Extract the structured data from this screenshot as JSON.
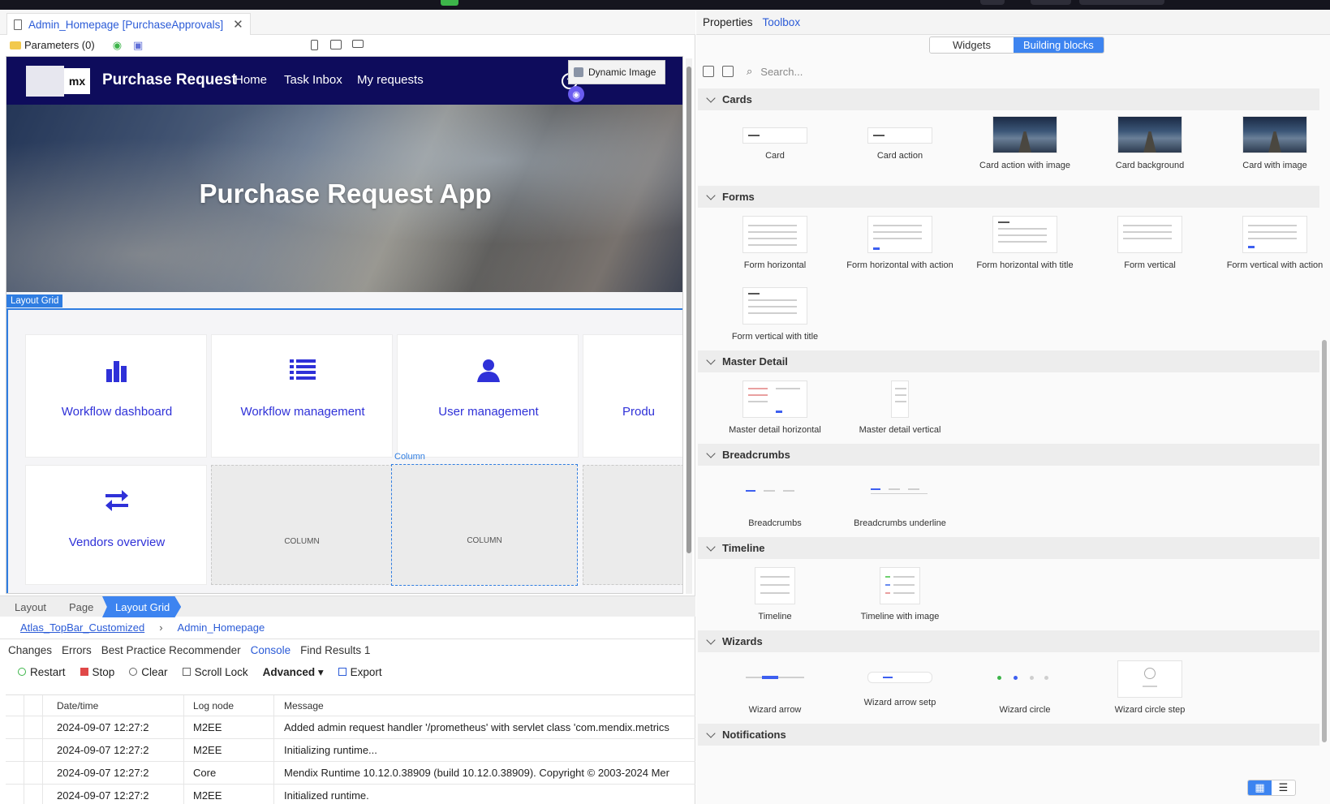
{
  "editor": {
    "doc_tab": "Admin_Homepage [PurchaseApprovals]",
    "params_label": "Parameters (0)"
  },
  "page": {
    "brand": "mx",
    "app_title": "Purchase Request",
    "nav": [
      "Home",
      "Task Inbox",
      "My requests"
    ],
    "dynamic_image": "Dynamic Image",
    "hero_title": "Purchase Request App",
    "layout_grid_tag": "Layout Grid",
    "column_tag": "Column",
    "tiles": [
      {
        "label": "Workflow dashboard",
        "icon": "bar-chart-icon"
      },
      {
        "label": "Workflow management",
        "icon": "list-icon"
      },
      {
        "label": "User management",
        "icon": "user-icon"
      },
      {
        "label": "Produ",
        "icon": "none"
      },
      {
        "label": "Vendors overview",
        "icon": "transfer-arrows-icon"
      }
    ],
    "empty_column": "COLUMN"
  },
  "breadcrumbs": [
    "Layout",
    "Page",
    "Layout Grid"
  ],
  "path": {
    "link": "Atlas_TopBar_Customized",
    "current": "Admin_Homepage"
  },
  "bottom_tabs": [
    "Changes",
    "Errors",
    "Best Practice Recommender",
    "Console",
    "Find Results 1"
  ],
  "console_toolbar": {
    "restart": "Restart",
    "stop": "Stop",
    "clear": "Clear",
    "scroll_lock": "Scroll Lock",
    "advanced": "Advanced",
    "export": "Export"
  },
  "log": {
    "headers": [
      "Date/time",
      "Log node",
      "Message"
    ],
    "rows": [
      {
        "time": "2024-09-07 12:27:2",
        "node": "M2EE",
        "msg": "Added admin request handler '/prometheus' with servlet class 'com.mendix.metrics"
      },
      {
        "time": "2024-09-07 12:27:2",
        "node": "M2EE",
        "msg": "Initializing runtime..."
      },
      {
        "time": "2024-09-07 12:27:2",
        "node": "Core",
        "msg": "Mendix Runtime 10.12.0.38909 (build 10.12.0.38909). Copyright © 2003-2024 Mer"
      },
      {
        "time": "2024-09-07 12:27:2",
        "node": "M2EE",
        "msg": "Initialized runtime."
      }
    ]
  },
  "toolbox": {
    "tabs": [
      "Properties",
      "Toolbox"
    ],
    "segments": [
      "Widgets",
      "Building blocks"
    ],
    "search_placeholder": "Search...",
    "sections": [
      {
        "title": "Cards",
        "items": [
          "Card",
          "Card action",
          "Card action with image",
          "Card background",
          "Card with image"
        ]
      },
      {
        "title": "Forms",
        "items": [
          "Form horizontal",
          "Form horizontal with action",
          "Form horizontal with title",
          "Form vertical",
          "Form vertical with action",
          "Form vertical with title"
        ]
      },
      {
        "title": "Master Detail",
        "items": [
          "Master detail horizontal",
          "Master detail vertical"
        ]
      },
      {
        "title": "Breadcrumbs",
        "items": [
          "Breadcrumbs",
          "Breadcrumbs underline"
        ]
      },
      {
        "title": "Timeline",
        "items": [
          "Timeline",
          "Timeline with image"
        ]
      },
      {
        "title": "Wizards",
        "items": [
          "Wizard arrow",
          "Wizard arrow setp",
          "Wizard circle",
          "Wizard circle step"
        ]
      },
      {
        "title": "Notifications",
        "items": []
      }
    ]
  },
  "colors": {
    "accent": "#3d84f0",
    "brand_dark": "#0e0c5c",
    "tile_blue": "#2f31d8"
  }
}
